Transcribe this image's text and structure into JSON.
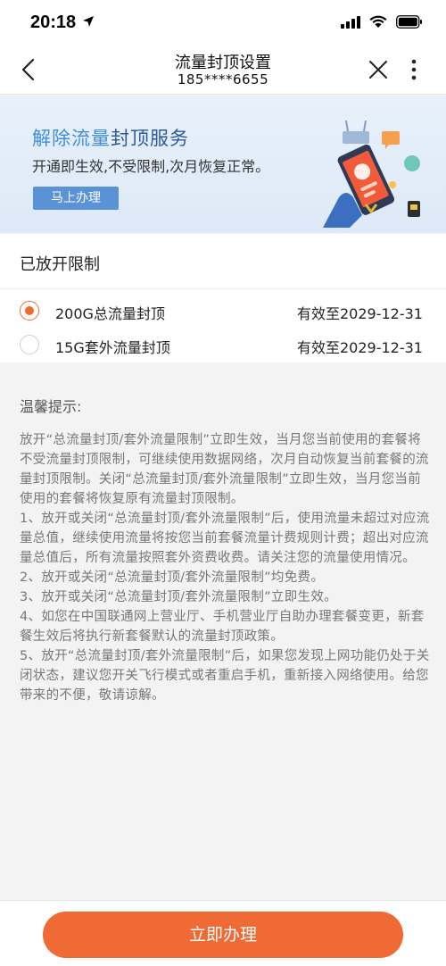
{
  "status_bar": {
    "time": "20:18"
  },
  "nav": {
    "title": "流量封顶设置",
    "subtitle": "185****6655"
  },
  "banner": {
    "title_part1": "解除流量",
    "title_part2": "封顶服务",
    "subtitle": "开通即生效,不受限制,次月恢复正常。",
    "button_label": "马上办理"
  },
  "section": {
    "title": "已放开限制"
  },
  "options": [
    {
      "label": "200G总流量封顶",
      "valid": "有效至2029-12-31",
      "checked": true
    },
    {
      "label": "15G套外流量封顶",
      "valid": "有效至2029-12-31",
      "checked": false
    }
  ],
  "tips": {
    "title": "温馨提示:",
    "paragraphs": [
      "放开“总流量封顶/套外流量限制”立即生效，当月您当前使用的套餐将不受流量封顶限制，可继续使用数据网络，次月自动恢复当前套餐的流量封顶限制。关闭“总流量封顶/套外流量限制”立即生效，当月您当前使用的套餐将恢复原有流量封顶限制。",
      "1、放开或关闭“总流量封顶/套外流量限制”后，使用流量未超过对应流量总值，继续使用流量将按您当前套餐流量计费规则计费；超出对应流量总值后，所有流量按照套外资费收费。请关注您的流量使用情况。",
      "2、放开或关闭“总流量封顶/套外流量限制”均免费。",
      "3、放开或关闭“总流量封顶/套外流量限制”立即生效。",
      "4、如您在中国联通网上营业厅、手机营业厅自助办理套餐变更，新套餐生效后将执行新套餐默认的流量封顶政策。",
      "5、放开“总流量封顶/套外流量限制”后，如果您发现上网功能仍处于关闭状态，建议您开关飞行模式或者重启手机，重新接入网络使用。给您带来的不便，敬请谅解。"
    ]
  },
  "submit": {
    "label": "立即办理"
  },
  "colors": {
    "accent": "#f06a35",
    "banner_button": "#5a92d8",
    "banner_title_blue": "#3f8ee0"
  }
}
